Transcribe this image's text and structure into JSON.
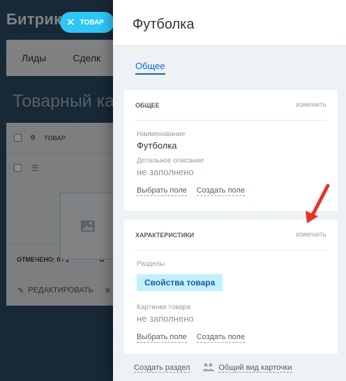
{
  "background": {
    "app_title": "Битрик",
    "close_button_label": "ТОВАР",
    "close_icon": "close-icon",
    "nav_items": [
      "Лиды",
      "Сделк"
    ],
    "page_title": "Товарный кат",
    "grid_header": "ТОВАР",
    "grid_settings_icon": "gear-icon",
    "grid_row_menu_icon": "menu-icon",
    "image_placeholder_icon": "image-icon",
    "checked_counter": "ОТМЕЧЕНО: 0 / 1",
    "counter_extra": "В",
    "edit_action": "РЕДАКТИРОВАТЬ",
    "delete_action": "✕",
    "edit_icon": "pencil-icon"
  },
  "panel": {
    "title": "Футболка",
    "tabs": [
      {
        "label": "Общее",
        "active": true
      }
    ],
    "general_card": {
      "title": "ОБЩЕЕ",
      "edit_label": "изменить",
      "fields": [
        {
          "label": "Наименование",
          "value": "Футболка",
          "empty": false
        },
        {
          "label": "Детальное описание",
          "value": "не заполнено",
          "empty": true
        }
      ],
      "select_field": "Выбрать поле",
      "create_field": "Создать поле"
    },
    "props_card": {
      "title": "ХАРАКТЕРИСТИКИ",
      "edit_label": "изменить",
      "sections_label": "Разделы",
      "sections_badge": "Свойства товара",
      "images_label": "Картинки товара",
      "images_value": "не заполнено",
      "select_field": "Выбрать поле",
      "create_field": "Создать поле"
    },
    "footer": {
      "create_section": "Создать раздел",
      "card_view": "Общий вид карточки",
      "card_view_icon": "users-icon"
    }
  },
  "colors": {
    "accent_blue": "#2fc6f6",
    "link_blue": "#0b66c3",
    "badge_bg": "#c3f0ff",
    "arrow_red": "#e8312a"
  }
}
